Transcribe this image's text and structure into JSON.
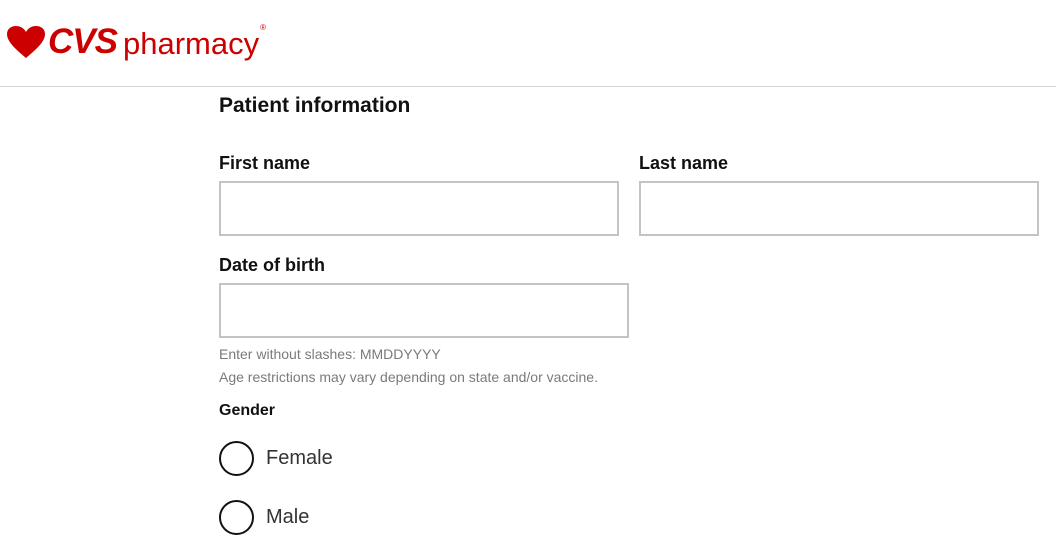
{
  "header": {
    "logo_brand": "CVS",
    "logo_product": "pharmacy",
    "logo_registered": "®",
    "logo_color": "#cc0000"
  },
  "form": {
    "section_title": "Patient information",
    "first_name": {
      "label": "First name",
      "value": "",
      "placeholder": ""
    },
    "last_name": {
      "label": "Last name",
      "value": "",
      "placeholder": ""
    },
    "date_of_birth": {
      "label": "Date of birth",
      "value": "",
      "placeholder": "",
      "hint_format": "Enter without slashes: MMDDYYYY",
      "hint_age": "Age restrictions may vary depending on state and/or vaccine."
    },
    "gender": {
      "label": "Gender",
      "options": [
        {
          "label": "Female",
          "selected": false
        },
        {
          "label": "Male",
          "selected": false
        }
      ]
    }
  }
}
